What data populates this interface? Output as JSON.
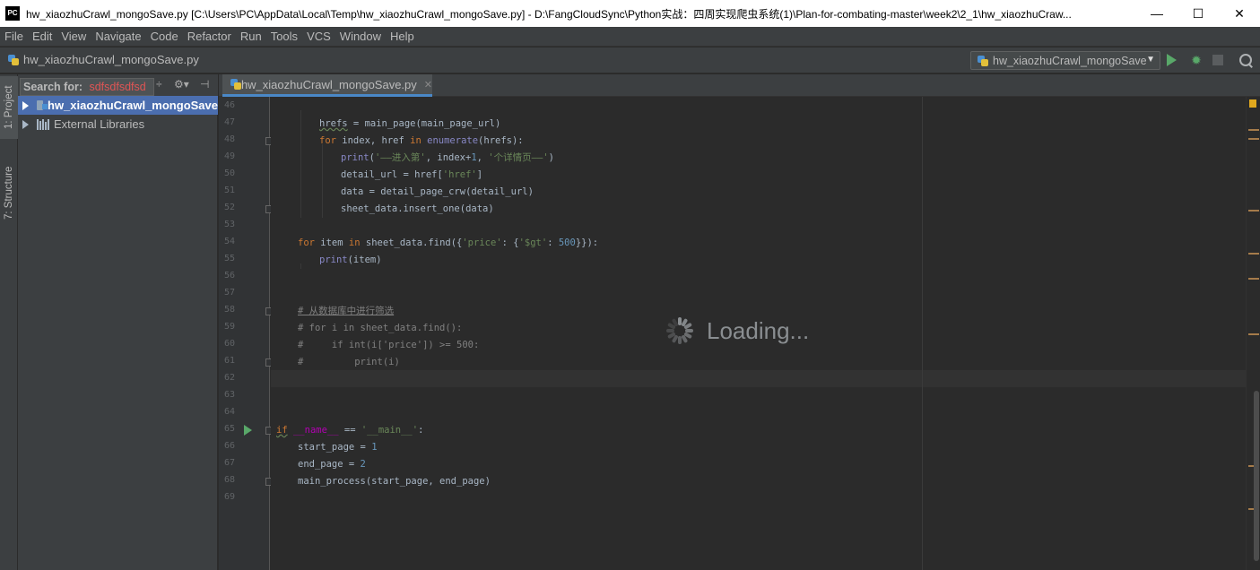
{
  "window": {
    "title": "hw_xiaozhuCrawl_mongoSave.py [C:\\Users\\PC\\AppData\\Local\\Temp\\hw_xiaozhuCrawl_mongoSave.py] - D:\\FangCloudSync\\Python实战：四周实现爬虫系统(1)\\Plan-for-combating-master\\week2\\2_1\\hw_xiaozhuCraw...",
    "logo_text": "PC",
    "minimize": "—",
    "maximize": "☐",
    "close": "✕"
  },
  "menu": [
    "File",
    "Edit",
    "View",
    "Navigate",
    "Code",
    "Refactor",
    "Run",
    "Tools",
    "VCS",
    "Window",
    "Help"
  ],
  "navbar": {
    "breadcrumb": "hw_xiaozhuCrawl_mongoSave.py",
    "run_config": "hw_xiaozhuCrawl_mongoSave"
  },
  "toolstrip": {
    "project_tab": "1: Project",
    "structure_tab": "7: Structure"
  },
  "project_panel": {
    "search_label": "Search for:",
    "search_query": "sdfsdfsdfsd",
    "tree": [
      {
        "label": "hw_xiaozhuCrawl_mongoSave",
        "selected": true
      },
      {
        "label": "External Libraries",
        "selected": false
      }
    ]
  },
  "editor_tab": {
    "label": "hw_xiaozhuCrawl_mongoSave.py",
    "close": "✕"
  },
  "editor": {
    "line_numbers": [
      "46",
      "47",
      "48",
      "49",
      "50",
      "51",
      "52",
      "53",
      "54",
      "55",
      "56",
      "57",
      "58",
      "59",
      "60",
      "61",
      "62",
      "63",
      "64",
      "65",
      "66",
      "67",
      "68",
      "69"
    ],
    "loading_text": "Loading..."
  },
  "colors": {
    "accent": "#4b6eaf",
    "keyword": "#cc7832",
    "string": "#6a8759",
    "number": "#6897bb",
    "comment": "#808080",
    "run": "#59a869"
  }
}
